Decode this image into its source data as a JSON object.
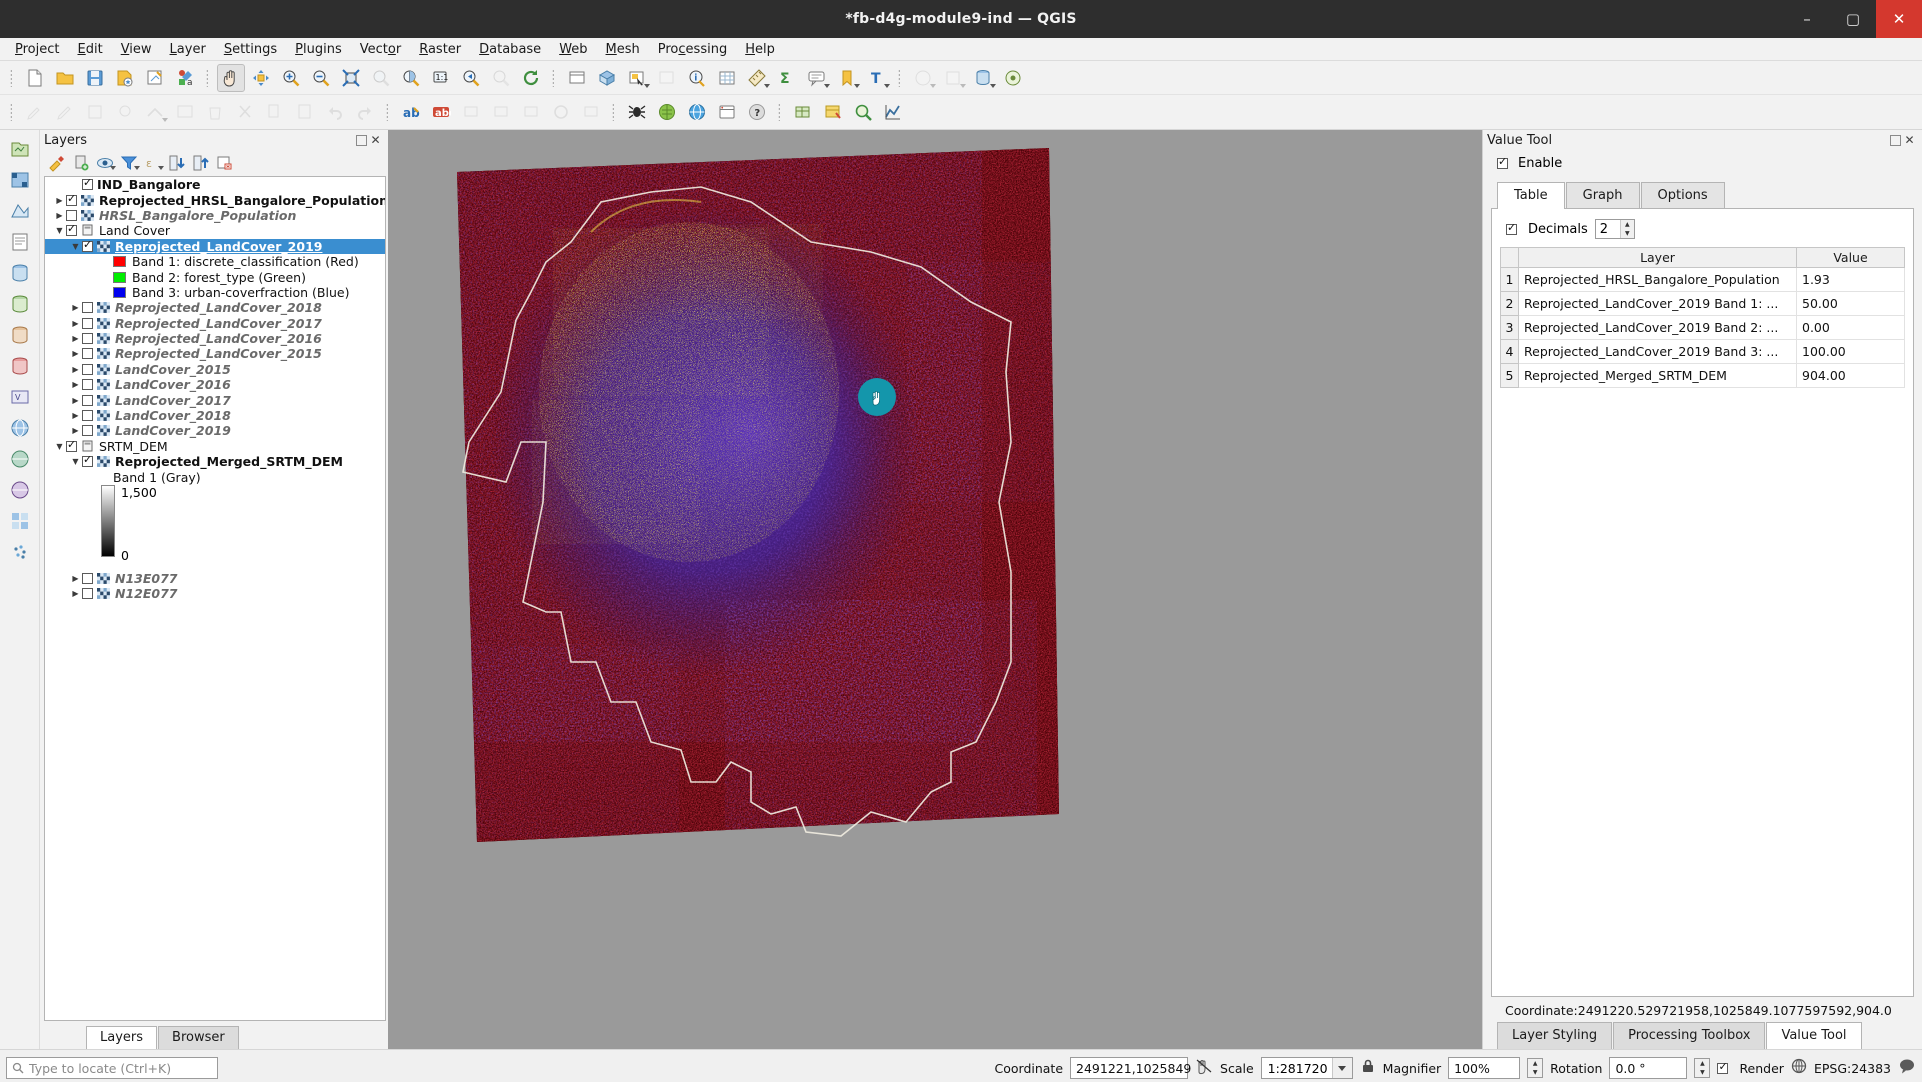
{
  "window": {
    "title": "*fb-d4g-module9-ind — QGIS",
    "minimize": "–",
    "maximize": "▢",
    "close": "✕"
  },
  "menubar": [
    {
      "label": "Project",
      "mnemonic": "P"
    },
    {
      "label": "Edit",
      "mnemonic": "E"
    },
    {
      "label": "View",
      "mnemonic": "V"
    },
    {
      "label": "Layer",
      "mnemonic": "L"
    },
    {
      "label": "Settings",
      "mnemonic": "S"
    },
    {
      "label": "Plugins",
      "mnemonic": "P"
    },
    {
      "label": "Vector",
      "mnemonic": "o"
    },
    {
      "label": "Raster",
      "mnemonic": "R"
    },
    {
      "label": "Database",
      "mnemonic": "D"
    },
    {
      "label": "Web",
      "mnemonic": "W"
    },
    {
      "label": "Mesh",
      "mnemonic": "M"
    },
    {
      "label": "Processing",
      "mnemonic": "c"
    },
    {
      "label": "Help",
      "mnemonic": "H"
    }
  ],
  "layers_panel": {
    "title": "Layers",
    "toolbar_icons": [
      "open-layer-styling-panel-icon",
      "add-group-icon",
      "manage-map-themes-icon",
      "filter-legend-icon",
      "filter-legend-expression-icon",
      "expand-all-icon",
      "collapse-all-icon",
      "remove-layer-icon"
    ],
    "tabs": [
      {
        "label": "Layers",
        "active": true
      },
      {
        "label": "Browser",
        "active": false
      }
    ],
    "tree": [
      {
        "label": "IND_Bangalore",
        "indent": 1,
        "checked": true,
        "expander": "",
        "icon": "none",
        "style": "bold"
      },
      {
        "label": "Reprojected_HRSL_Bangalore_Population",
        "indent": 0,
        "checked": true,
        "expander": "collapsed",
        "icon": "raster",
        "style": "bold"
      },
      {
        "label": "HRSL_Bangalore_Population",
        "indent": 0,
        "checked": false,
        "expander": "collapsed",
        "icon": "raster",
        "style": "italic-gray-bold"
      },
      {
        "label": "Land Cover",
        "indent": 0,
        "checked": true,
        "expander": "expanded",
        "icon": "group",
        "style": "normal"
      },
      {
        "label": "Reprojected_LandCover_2019",
        "indent": 1,
        "checked": true,
        "expander": "expanded",
        "icon": "raster",
        "style": "selected"
      },
      {
        "label": "Band 1: discrete_classification (Red)",
        "indent": 2,
        "checked": null,
        "expander": "",
        "icon": "swatch",
        "color": "#ff0000",
        "style": "normal"
      },
      {
        "label": "Band 2: forest_type (Green)",
        "indent": 2,
        "checked": null,
        "expander": "",
        "icon": "swatch",
        "color": "#00ee00",
        "style": "normal"
      },
      {
        "label": "Band 3: urban-coverfraction (Blue)",
        "indent": 2,
        "checked": null,
        "expander": "",
        "icon": "swatch",
        "color": "#0000ee",
        "style": "normal"
      },
      {
        "label": "Reprojected_LandCover_2018",
        "indent": 1,
        "checked": false,
        "expander": "collapsed",
        "icon": "raster",
        "style": "italic-gray-bold"
      },
      {
        "label": "Reprojected_LandCover_2017",
        "indent": 1,
        "checked": false,
        "expander": "collapsed",
        "icon": "raster",
        "style": "italic-gray-bold"
      },
      {
        "label": "Reprojected_LandCover_2016",
        "indent": 1,
        "checked": false,
        "expander": "collapsed",
        "icon": "raster",
        "style": "italic-gray-bold"
      },
      {
        "label": "Reprojected_LandCover_2015",
        "indent": 1,
        "checked": false,
        "expander": "collapsed",
        "icon": "raster",
        "style": "italic-gray-bold"
      },
      {
        "label": "LandCover_2015",
        "indent": 1,
        "checked": false,
        "expander": "collapsed",
        "icon": "raster",
        "style": "italic-gray-bold"
      },
      {
        "label": "LandCover_2016",
        "indent": 1,
        "checked": false,
        "expander": "collapsed",
        "icon": "raster",
        "style": "italic-gray-bold"
      },
      {
        "label": "LandCover_2017",
        "indent": 1,
        "checked": false,
        "expander": "collapsed",
        "icon": "raster",
        "style": "italic-gray-bold"
      },
      {
        "label": "LandCover_2018",
        "indent": 1,
        "checked": false,
        "expander": "collapsed",
        "icon": "raster",
        "style": "italic-gray-bold"
      },
      {
        "label": "LandCover_2019",
        "indent": 1,
        "checked": false,
        "expander": "collapsed",
        "icon": "raster",
        "style": "italic-gray-bold"
      },
      {
        "label": "SRTM_DEM",
        "indent": 0,
        "checked": true,
        "expander": "expanded",
        "icon": "group",
        "style": "normal"
      },
      {
        "label": "Reprojected_Merged_SRTM_DEM",
        "indent": 1,
        "checked": true,
        "expander": "expanded",
        "icon": "raster",
        "style": "bold"
      },
      {
        "label": "Band 1 (Gray)",
        "indent": 2,
        "checked": null,
        "expander": "",
        "icon": "none",
        "style": "normal"
      }
    ],
    "dem_legend": {
      "max_label": "1,500",
      "min_label": "0",
      "gradient_top": "#ffffff",
      "gradient_bottom": "#000000"
    },
    "tree_tail": [
      {
        "label": "N13E077",
        "indent": 1,
        "checked": false,
        "expander": "collapsed",
        "icon": "raster",
        "style": "italic-gray-bold"
      },
      {
        "label": "N12E077",
        "indent": 1,
        "checked": false,
        "expander": "collapsed",
        "icon": "raster",
        "style": "italic-gray-bold"
      }
    ]
  },
  "value_tool": {
    "title": "Value Tool",
    "enable_label": "Enable",
    "enable_checked": true,
    "tabs": [
      {
        "label": "Table",
        "active": true
      },
      {
        "label": "Graph",
        "active": false
      },
      {
        "label": "Options",
        "active": false
      }
    ],
    "decimals_label": "Decimals",
    "decimals_checked": true,
    "decimals_value": "2",
    "table": {
      "columns": [
        "Layer",
        "Value"
      ],
      "rows": [
        {
          "n": "1",
          "layer": "Reprojected_HRSL_Bangalore_Population",
          "value": "1.93"
        },
        {
          "n": "2",
          "layer": "Reprojected_LandCover_2019 Band 1: ...",
          "value": "50.00"
        },
        {
          "n": "3",
          "layer": "Reprojected_LandCover_2019 Band 2: ...",
          "value": "0.00"
        },
        {
          "n": "4",
          "layer": "Reprojected_LandCover_2019 Band 3: ...",
          "value": "100.00"
        },
        {
          "n": "5",
          "layer": "Reprojected_Merged_SRTM_DEM",
          "value": "904.00"
        }
      ]
    },
    "coordinate_line": "Coordinate:2491220.529721958,1025849.1077597592,904.0",
    "bottom_tabs": [
      {
        "label": "Layer Styling",
        "active": false
      },
      {
        "label": "Processing Toolbox",
        "active": false
      },
      {
        "label": "Value Tool",
        "active": true
      }
    ]
  },
  "statusbar": {
    "locator_placeholder": "Type to locate (Ctrl+K)",
    "coordinate_label": "Coordinate",
    "coordinate_value": "2491221,1025849",
    "scale_label": "Scale",
    "scale_value": "1:281720",
    "magnifier_label": "Magnifier",
    "magnifier_value": "100%",
    "rotation_label": "Rotation",
    "rotation_value": "0.0 °",
    "render_label": "Render",
    "render_checked": true,
    "crs_label": "EPSG:24383"
  }
}
